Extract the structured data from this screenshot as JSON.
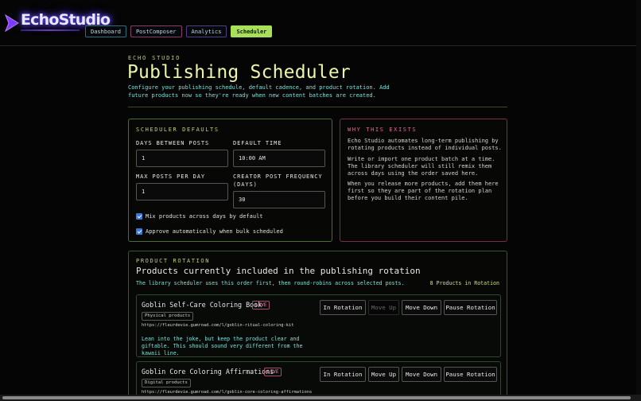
{
  "brand": {
    "name": "EchoStudio"
  },
  "nav": {
    "tabs": [
      "Dashboard",
      "PostComposer",
      "Analytics",
      "Scheduler"
    ],
    "active": "Scheduler"
  },
  "header": {
    "eyebrow": "ECHO STUDIO",
    "title": "Publishing Scheduler",
    "description": "Configure your publishing schedule, default cadence, and product rotation. Add future products now so they're ready when new content batches are created."
  },
  "defaults": {
    "heading": "SCHEDULER DEFAULTS",
    "days_between_posts": {
      "label": "DAYS BETWEEN POSTS",
      "value": "1"
    },
    "default_time": {
      "label": "DEFAULT TIME",
      "value": "10:00 AM"
    },
    "max_posts_per_day": {
      "label": "MAX POSTS PER DAY",
      "value": "1"
    },
    "creator_post_frequency": {
      "label": "CREATOR POST FREQUENCY (DAYS)",
      "value": "30"
    },
    "mix_products": {
      "label": "Mix products across days by default",
      "checked": true
    },
    "auto_approve": {
      "label": "Approve automatically when bulk scheduled",
      "checked": true
    }
  },
  "why": {
    "heading": "WHY THIS EXISTS",
    "paragraphs": [
      "Echo Studio automates long-term publishing by rotating products instead of individual posts.",
      "Write or import one product batch at a time. The library scheduler will still remix them across days using the order saved here.",
      "When you release more products, add them here first so they are part of the rotation plan before you build their content pile."
    ]
  },
  "rotation": {
    "heading": "PRODUCT ROTATION",
    "title": "Products currently included in the publishing rotation",
    "description": "The library scheduler uses this order first, then round-robins across selected posts.",
    "count_label": "8 Products in Rotation",
    "products": [
      {
        "name": "Goblin Self-Care Coloring Book",
        "status": "LIVE",
        "category": "Physical products",
        "url": "https://fleurdevie.gumroad.com/l/goblin-ritual-coloring-kit",
        "note": "Lean into the joke, but keep the product clear and giftable. This should sound very different from the kawaii line.",
        "actions": {
          "rotation": "In Rotation",
          "move_up": "Move Up",
          "move_down": "Move Down",
          "pause": "Pause Rotation"
        },
        "move_up_disabled": true
      },
      {
        "name": "Goblin Core Coloring Affirmations",
        "status": "LIVE",
        "category": "Digital products",
        "url": "https://fleurdevie.gumroad.com/l/goblin-core-coloring-affirmations",
        "note": "",
        "actions": {
          "rotation": "In Rotation",
          "move_up": "Move Up",
          "move_down": "Move Down",
          "pause": "Pause Rotation"
        },
        "move_up_disabled": false
      }
    ]
  }
}
